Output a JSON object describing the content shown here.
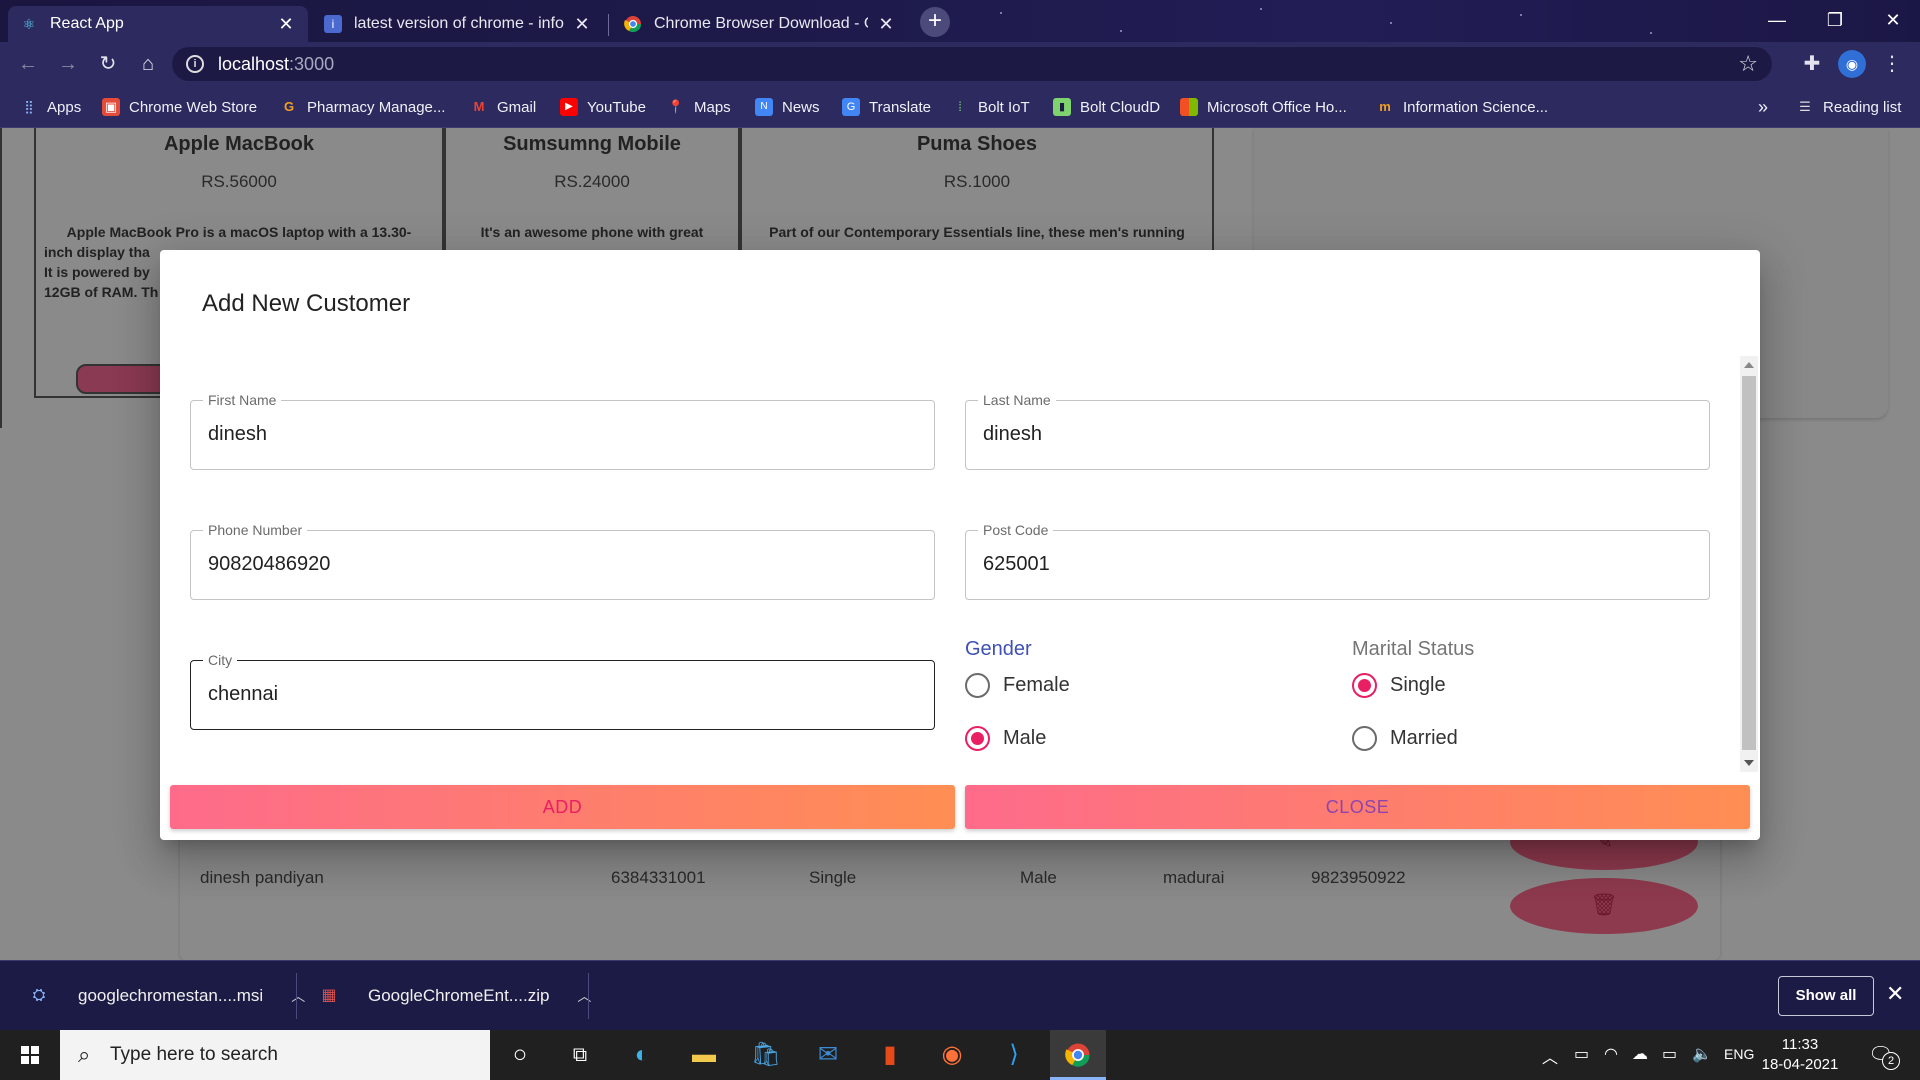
{
  "browser": {
    "tabs": [
      {
        "title": "React App",
        "favicon": "react-icon"
      },
      {
        "title": "latest version of chrome - info.co",
        "favicon": "info-icon"
      },
      {
        "title": "Chrome Browser Download - Chr",
        "favicon": "chrome-icon"
      }
    ],
    "url_host": "localhost",
    "url_port": ":3000",
    "bookmarks": [
      {
        "label": "Apps",
        "icon": "apps-grid-icon"
      },
      {
        "label": "Chrome Web Store",
        "icon": "web-store-icon"
      },
      {
        "label": "Pharmacy Manage...",
        "icon": "pharmacy-icon"
      },
      {
        "label": "Gmail",
        "icon": "gmail-icon"
      },
      {
        "label": "YouTube",
        "icon": "youtube-icon"
      },
      {
        "label": "Maps",
        "icon": "maps-icon"
      },
      {
        "label": "News",
        "icon": "news-icon"
      },
      {
        "label": "Translate",
        "icon": "translate-icon"
      },
      {
        "label": "Bolt IoT",
        "icon": "bolt-iot-icon"
      },
      {
        "label": "Bolt CloudD",
        "icon": "bolt-cloud-icon"
      },
      {
        "label": "Microsoft Office Ho...",
        "icon": "office-icon"
      },
      {
        "label": "Information Science...",
        "icon": "info-science-icon"
      }
    ],
    "bookmarks_overflow": "»",
    "reading_list": "Reading list"
  },
  "background": {
    "products": [
      {
        "name": "Apple MacBook",
        "price": "RS.56000",
        "desc_lines": [
          "Apple MacBook Pro is a macOS laptop with a 13.30-",
          "inch display tha",
          "It is powered by",
          "12GB of RAM. Th"
        ]
      },
      {
        "name": "Sumsumng Mobile",
        "price": "RS.24000",
        "desc_lines": [
          "It's an awesome phone with great"
        ]
      },
      {
        "name": "Puma Shoes",
        "price": "RS.1000",
        "desc_lines": [
          "Part of our Contemporary Essentials line, these men's running"
        ]
      }
    ],
    "customer_row": {
      "name": "dinesh pandiyan",
      "phone": "6384331001",
      "marital": "Single",
      "gender": "Male",
      "city": "madurai",
      "postcode": "9823950922"
    }
  },
  "modal": {
    "title": "Add New Customer",
    "fields": {
      "first_name": {
        "label": "First Name",
        "value": "dinesh"
      },
      "last_name": {
        "label": "Last Name",
        "value": "dinesh"
      },
      "phone": {
        "label": "Phone Number",
        "value": "90820486920"
      },
      "post_code": {
        "label": "Post Code",
        "value": "625001"
      },
      "city": {
        "label": "City",
        "value": "chennai"
      }
    },
    "gender": {
      "label": "Gender",
      "options": [
        "Female",
        "Male"
      ],
      "selected": "Male"
    },
    "marital_status": {
      "label": "Marital Status",
      "options": [
        "Single",
        "Married"
      ],
      "selected": "Single"
    },
    "add_label": "ADD",
    "close_label": "CLOSE"
  },
  "downloads": {
    "items": [
      {
        "name": "googlechromestan....msi"
      },
      {
        "name": "GoogleChromeEnt....zip"
      }
    ],
    "show_all": "Show all"
  },
  "taskbar": {
    "search_placeholder": "Type here to search",
    "language": "ENG",
    "time": "11:33",
    "date": "18-04-2021",
    "notification_count": "2"
  },
  "colors": {
    "accent": "#e91e63",
    "gradient_start": "#fe6b8b",
    "gradient_end": "#ff8e53",
    "focus_label": "#3f51b5"
  }
}
